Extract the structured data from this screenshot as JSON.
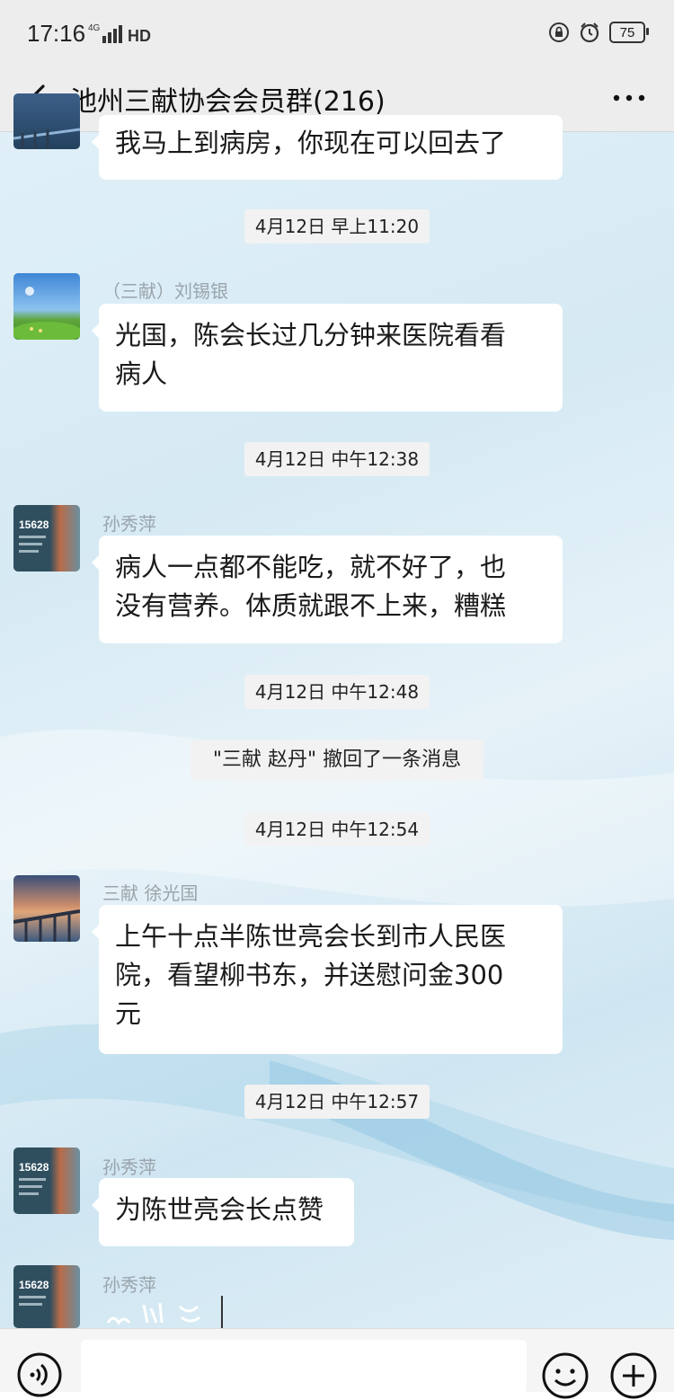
{
  "status_bar": {
    "time": "17:16",
    "network": "4G",
    "hd": "HD",
    "battery": "75"
  },
  "nav": {
    "title": "池州三献协会会员群(216)"
  },
  "messages": [
    {
      "text": "我马上到病房，你现在可以回去了"
    },
    {
      "timestamp": "4月12日 早上11:20"
    },
    {
      "sender": "（三献）刘锡银",
      "text_lines": [
        "光国，陈会长过几分钟来医院看看",
        "病人"
      ]
    },
    {
      "timestamp": "4月12日 中午12:38"
    },
    {
      "sender": "孙秀萍",
      "text_lines": [
        "病人一点都不能吃，就不好了，也",
        "没有营养。体质就跟不上来，糟糕"
      ]
    },
    {
      "timestamp": "4月12日 中午12:48"
    },
    {
      "system": "\"三献 赵丹\" 撤回了一条消息"
    },
    {
      "timestamp": "4月12日 中午12:54"
    },
    {
      "sender": "三献 徐光国",
      "text_lines": [
        "上午十点半陈世亮会长到市人民医",
        "院，看望柳书东，并送慰问金300",
        "元"
      ]
    },
    {
      "timestamp": "4月12日 中午12:57"
    },
    {
      "sender": "孙秀萍",
      "text": "为陈世亮会长点赞"
    },
    {
      "sender": "孙秀萍"
    }
  ],
  "avatar_badge": "15628",
  "icons": [
    "back-icon",
    "more-icon",
    "voice-icon",
    "emoji-icon",
    "plus-icon"
  ]
}
